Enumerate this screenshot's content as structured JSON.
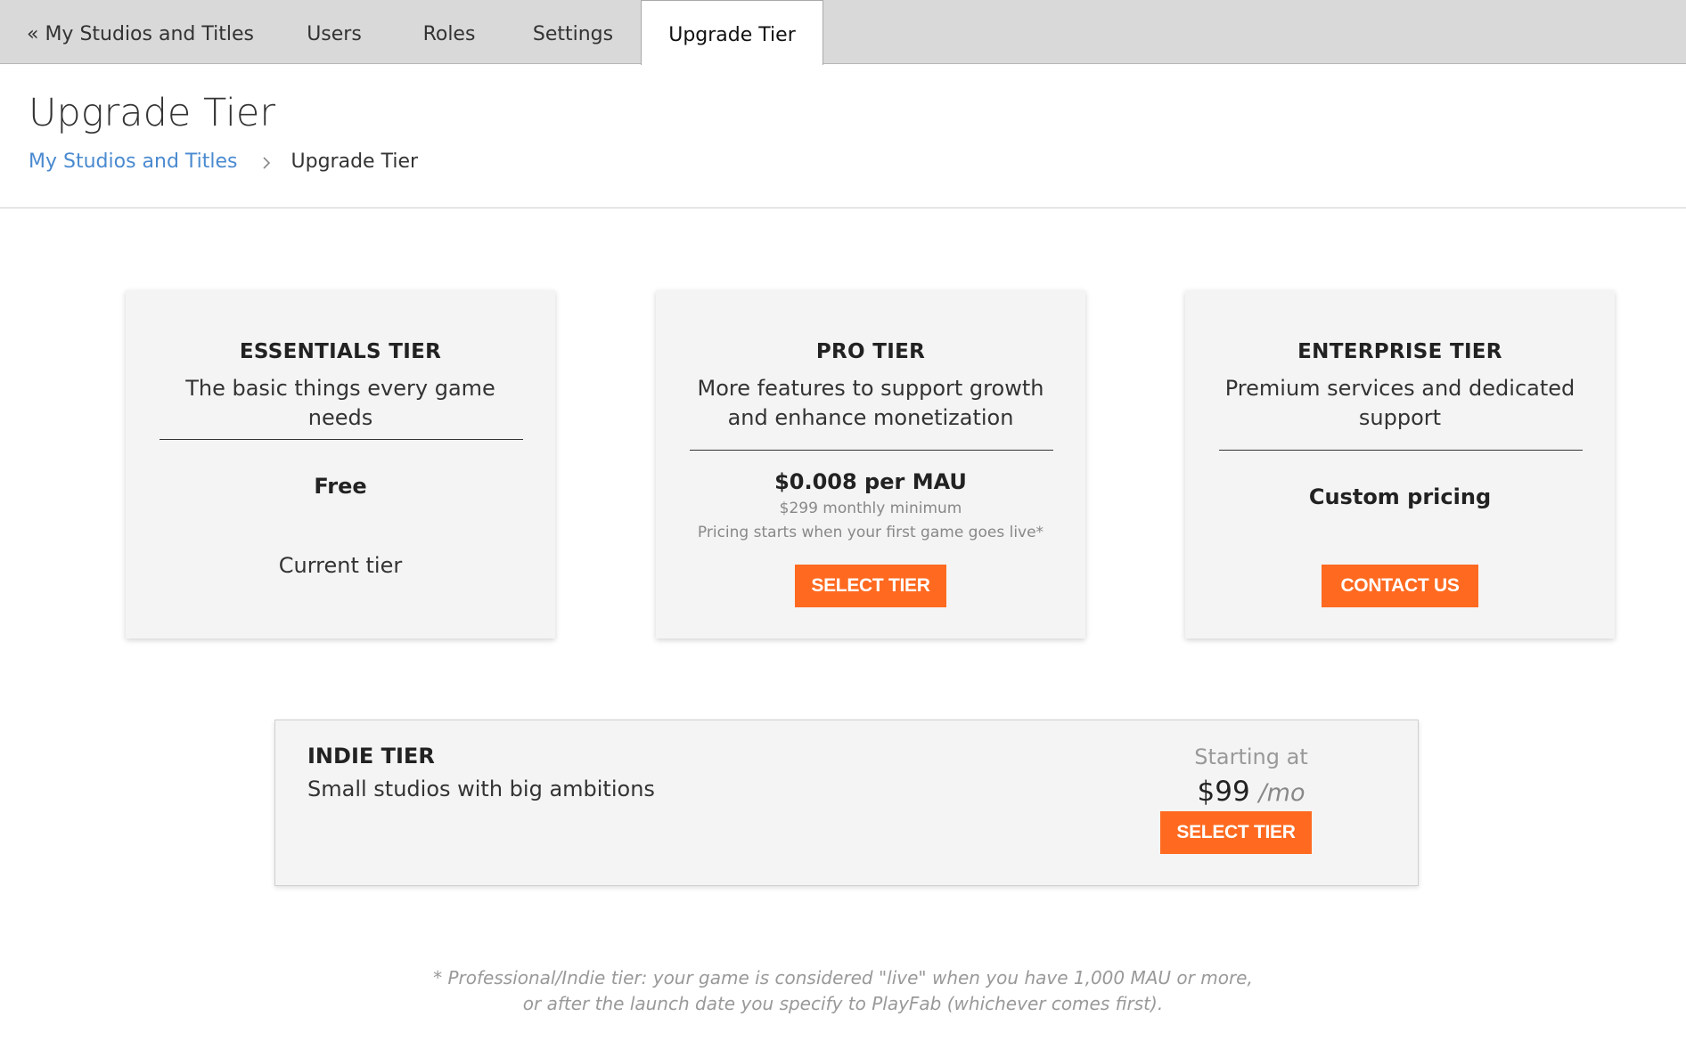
{
  "tabs": [
    {
      "label": "« My Studios and Titles"
    },
    {
      "label": "Users"
    },
    {
      "label": "Roles"
    },
    {
      "label": "Settings"
    },
    {
      "label": "Upgrade Tier"
    }
  ],
  "active_tab": "Upgrade Tier",
  "page": {
    "title": "Upgrade Tier",
    "breadcrumb": {
      "link": "My Studios and Titles",
      "current": "Upgrade Tier"
    }
  },
  "tiers": {
    "essentials": {
      "title": "ESSENTIALS TIER",
      "description": "The basic things every game needs",
      "price": "Free",
      "status": "Current tier"
    },
    "pro": {
      "title": "PRO TIER",
      "description": "More features to support growth and enhance monetization",
      "price": "$0.008 per MAU",
      "minimum": "$299 monthly minimum",
      "note": "Pricing starts when your first game goes live*",
      "button": "Select Tier"
    },
    "enterprise": {
      "title": "ENTERPRISE TIER",
      "description": "Premium services and dedicated support",
      "price": "Custom pricing",
      "button": "Contact Us"
    },
    "indie": {
      "title": "INDIE TIER",
      "description": "Small studios with big ambitions",
      "starting_label": "Starting at",
      "price": "$99",
      "period": "/mo",
      "button": "Select Tier"
    }
  },
  "footnote": {
    "line1": "* Professional/Indie tier: your game is considered \"live\" when you have 1,000 MAU or more,",
    "line2": "or after the launch date you specify to PlayFab (whichever comes first)."
  },
  "colors": {
    "accent_button": "#ff6a20",
    "link": "#4a8ad0",
    "tab_bar": "#d9d9d9",
    "card_bg": "#f4f4f4"
  }
}
